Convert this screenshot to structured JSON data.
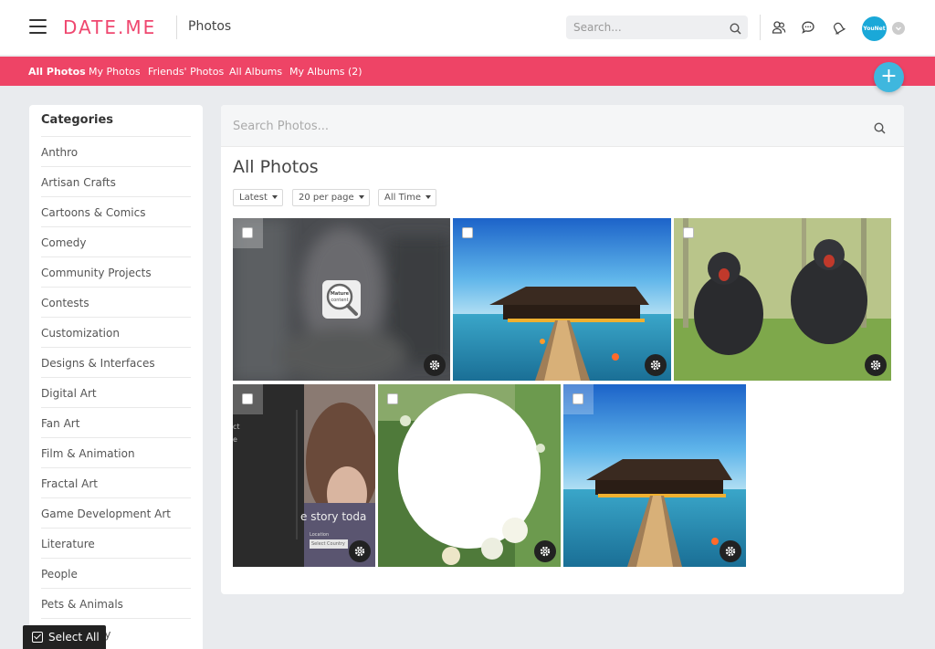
{
  "header": {
    "logo": "DATE.ME",
    "page_name": "Photos",
    "search_placeholder": "Search...",
    "avatar_text": "YouNet"
  },
  "subnav": {
    "tabs": [
      {
        "label": "All Photos",
        "active": true
      },
      {
        "label": "My Photos"
      },
      {
        "label": "Friends' Photos"
      },
      {
        "label": "All Albums"
      },
      {
        "label": "My Albums (2)"
      }
    ],
    "add_label": "+"
  },
  "sidebar": {
    "title": "Categories",
    "items": [
      "Anthro",
      "Artisan Crafts",
      "Cartoons & Comics",
      "Comedy",
      "Community Projects",
      "Contests",
      "Customization",
      "Designs & Interfaces",
      "Digital Art",
      "Fan Art",
      "Film & Animation",
      "Fractal Art",
      "Game Development Art",
      "Literature",
      "People",
      "Pets & Animals",
      "Photography"
    ]
  },
  "main": {
    "search_placeholder": "Search Photos...",
    "title": "All Photos",
    "filters": {
      "sort": "Latest",
      "per_page": "20 per page",
      "time": "All Time"
    },
    "mature_label_1": "Mature",
    "mature_label_2": "content",
    "photo4_text": "e story toda",
    "photo4_menu_1": "ct",
    "photo4_menu_2": "e",
    "photo4_location": "Location",
    "photo4_select": "Select Country"
  },
  "select_all_label": "Select All",
  "colors": {
    "brand": "#ee4466",
    "fab": "#3fb7de"
  }
}
